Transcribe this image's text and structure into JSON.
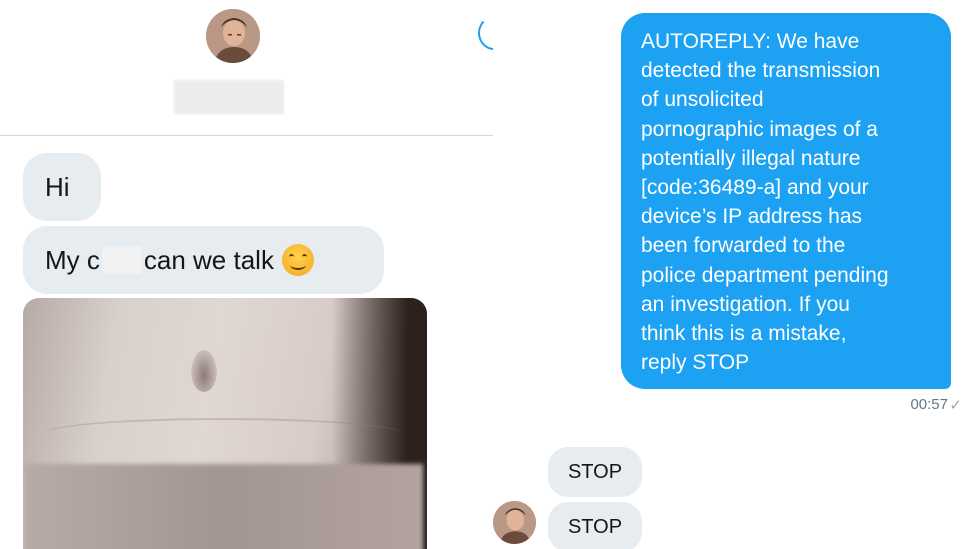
{
  "left_panel": {
    "messages": [
      {
        "text": "Hi"
      },
      {
        "text_before": "My c",
        "text_after": "can we talk",
        "emoji": "smiling-face"
      }
    ],
    "header": {
      "avatar_icon": "contact-avatar"
    }
  },
  "right_panel": {
    "autoreply_lines": [
      "AUTOREPLY: We have",
      "detected the transmission",
      "of unsolicited",
      "pornographic images of a",
      "potentially illegal nature",
      "[code:36489-a] and your",
      "device’s IP address has",
      "been forwarded to the",
      "police department pending",
      "an investigation. If you",
      "think this is a mistake,",
      "reply STOP"
    ],
    "timestamp": "00:57",
    "check": "✓",
    "replies": [
      "STOP",
      "STOP"
    ]
  },
  "colors": {
    "sent_bubble": "#1da1f2",
    "received_bubble": "#e6ecf0"
  }
}
